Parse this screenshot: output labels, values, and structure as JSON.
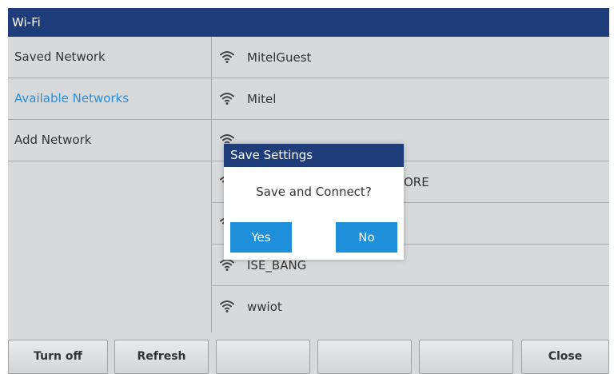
{
  "window": {
    "title": "Wi-Fi"
  },
  "sidebar": {
    "items": [
      {
        "label": "Saved Network",
        "active": false
      },
      {
        "label": "Available Networks",
        "active": true
      },
      {
        "label": "Add Network",
        "active": false
      }
    ]
  },
  "networks": [
    {
      "name": "MitelGuest",
      "icon": "wifi-icon"
    },
    {
      "name": "Mitel",
      "icon": "wifi-icon"
    },
    {
      "name": "",
      "icon": "wifi-icon"
    },
    {
      "name": "ORE",
      "icon": "wifi-icon"
    },
    {
      "name": "",
      "icon": "wifi-icon"
    },
    {
      "name": "ISE_BANG",
      "icon": "wifi-icon"
    },
    {
      "name": "wwiot",
      "icon": "wifi-icon"
    }
  ],
  "softkeys": [
    "Turn off",
    "Refresh",
    "",
    "",
    "",
    "Close"
  ],
  "dialog": {
    "title": "Save Settings",
    "message": "Save and Connect?",
    "yes_label": "Yes",
    "no_label": "No"
  },
  "colors": {
    "title_bar": "#1f3d7a",
    "accent": "#2a8fd4",
    "dialog_button": "#1e8fd8",
    "background": "#d7d9db"
  }
}
